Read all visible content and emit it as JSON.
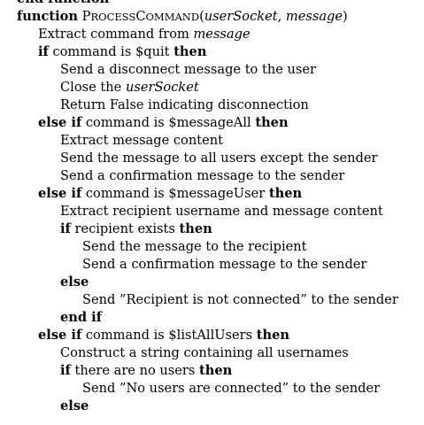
{
  "algorithm": {
    "lines": [
      {
        "indent": 0,
        "parts": [
          {
            "t": "end function",
            "s": "kw"
          }
        ]
      },
      {
        "indent": 0,
        "parts": [
          {
            "t": "function",
            "s": "kw"
          },
          {
            "t": " "
          },
          {
            "t": "P",
            "s": "sc-big"
          },
          {
            "t": "ROCESS",
            "s": "sc-small"
          },
          {
            "t": "C",
            "s": "sc-big"
          },
          {
            "t": "OMMAND",
            "s": "sc-small"
          },
          {
            "t": "("
          },
          {
            "t": "userSocket",
            "s": "it"
          },
          {
            "t": ", "
          },
          {
            "t": "message",
            "s": "it"
          },
          {
            "t": ")"
          }
        ]
      },
      {
        "indent": 1,
        "parts": [
          {
            "t": "Extract command from "
          },
          {
            "t": "message",
            "s": "it"
          }
        ]
      },
      {
        "indent": 1,
        "parts": [
          {
            "t": "if",
            "s": "kw"
          },
          {
            "t": " command is $quit "
          },
          {
            "t": "then",
            "s": "kw"
          }
        ]
      },
      {
        "indent": 2,
        "parts": [
          {
            "t": "Send a disconnect message to the user"
          }
        ]
      },
      {
        "indent": 2,
        "parts": [
          {
            "t": "Close the "
          },
          {
            "t": "userSocket",
            "s": "it"
          }
        ]
      },
      {
        "indent": 2,
        "parts": [
          {
            "t": "Return False indicating disconnection"
          }
        ]
      },
      {
        "indent": 1,
        "parts": [
          {
            "t": "else if",
            "s": "kw"
          },
          {
            "t": " command is $messageAll "
          },
          {
            "t": "then",
            "s": "kw"
          }
        ]
      },
      {
        "indent": 2,
        "parts": [
          {
            "t": "Extract message content"
          }
        ]
      },
      {
        "indent": 2,
        "parts": [
          {
            "t": "Send the message to all users except the sender"
          }
        ]
      },
      {
        "indent": 2,
        "parts": [
          {
            "t": "Send a confirmation message to the sender"
          }
        ]
      },
      {
        "indent": 1,
        "parts": [
          {
            "t": "else if",
            "s": "kw"
          },
          {
            "t": " command is $messageUser "
          },
          {
            "t": "then",
            "s": "kw"
          }
        ]
      },
      {
        "indent": 2,
        "parts": [
          {
            "t": "Extract recipient username and message content"
          }
        ]
      },
      {
        "indent": 2,
        "parts": [
          {
            "t": "if",
            "s": "kw"
          },
          {
            "t": " recipient exists "
          },
          {
            "t": "then",
            "s": "kw"
          }
        ]
      },
      {
        "indent": 3,
        "parts": [
          {
            "t": "Send the message to the recipient"
          }
        ]
      },
      {
        "indent": 3,
        "parts": [
          {
            "t": "Send a confirmation message to the sender"
          }
        ]
      },
      {
        "indent": 2,
        "parts": [
          {
            "t": "else",
            "s": "kw"
          }
        ]
      },
      {
        "indent": 3,
        "parts": [
          {
            "t": "Send ”Recipient is not connected” to the sender"
          }
        ]
      },
      {
        "indent": 2,
        "parts": [
          {
            "t": "end if",
            "s": "kw"
          }
        ]
      },
      {
        "indent": 1,
        "parts": [
          {
            "t": "else if",
            "s": "kw"
          },
          {
            "t": " command is $listAllUsers "
          },
          {
            "t": "then",
            "s": "kw"
          }
        ]
      },
      {
        "indent": 2,
        "parts": [
          {
            "t": "Construct a string containing all usernames"
          }
        ]
      },
      {
        "indent": 2,
        "parts": [
          {
            "t": "if",
            "s": "kw"
          },
          {
            "t": " there are no users "
          },
          {
            "t": "then",
            "s": "kw"
          }
        ]
      },
      {
        "indent": 3,
        "parts": [
          {
            "t": "Send ”No users are connected” to the sender"
          }
        ]
      },
      {
        "indent": 2,
        "parts": [
          {
            "t": "else",
            "s": "kw"
          }
        ]
      }
    ]
  }
}
